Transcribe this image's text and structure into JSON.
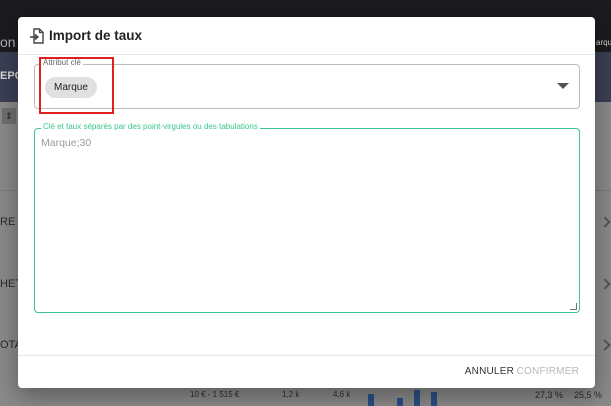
{
  "background": {
    "top_left_text": "on",
    "top_right_text": "arqu",
    "sub_left_text": "EPO",
    "row_labels": [
      "RE TE",
      "HETT",
      "OTA C"
    ],
    "bottom_values": [
      "10 € - 1 515 €",
      "1,2 k",
      "4,6 k",
      "27,3 %",
      "25,5 %"
    ]
  },
  "dialog": {
    "title": "Import de taux",
    "key_field": {
      "label": "Attribut clé",
      "selected_value": "Marque"
    },
    "text_field": {
      "label": "Clé et taux séparés par des point-virgules ou des tabulations",
      "placeholder": "Marque;30",
      "value": ""
    },
    "actions": {
      "cancel_label": "ANNULER",
      "confirm_label": "CONFIRMER"
    }
  },
  "colors": {
    "accent_green": "#3cc58a",
    "highlight_red": "#e0201f",
    "disabled_text": "#b7b7b7"
  },
  "icons": {
    "title_icon": "file-import-icon",
    "dropdown_icon": "caret-down-icon"
  }
}
